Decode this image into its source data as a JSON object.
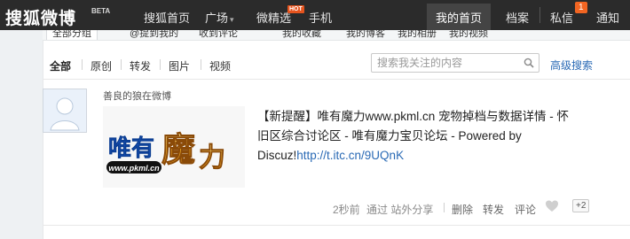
{
  "topnav": {
    "logo": "搜狐微博",
    "beta": "BETA",
    "items": [
      "搜狐首页",
      "广场",
      "微精选",
      "手机",
      "我的首页",
      "档案",
      "私信",
      "通知"
    ],
    "hot_badge": "HOT",
    "message_count": "1",
    "plaza_caret": "▾"
  },
  "groupbar": {
    "items": [
      "全部分组",
      "@提到我的",
      "收到评论",
      "我的收藏",
      "我的博客",
      "我的相册",
      "我的视频"
    ]
  },
  "filters": {
    "items": [
      "全部",
      "原创",
      "转发",
      "图片",
      "视频"
    ]
  },
  "search": {
    "placeholder": "搜索我关注的内容",
    "advanced_label": "高级搜索"
  },
  "post": {
    "author": "善良的狼在微博",
    "thumbnail": {
      "logo_text": "唯有魔力",
      "url_text": "www.pkml.cn"
    },
    "text_lines": [
      "【新提醒】唯有魔力www.pkml.cn 宠物掉档与数据详情 - 怀",
      "旧区综合讨论区 - 唯有魔力宝贝论坛 - Powered by"
    ],
    "text_tail": "Discuz!",
    "link": "http://t.itc.cn/9UQnK",
    "meta": {
      "time": "2秒前",
      "via": "通过 站外分享",
      "delete": "删除",
      "repost": "转发",
      "comment": "评论",
      "like_extra": "+2"
    }
  },
  "colors": {
    "topbar": "#2b2b2b",
    "link": "#2a6ab5",
    "hot": "#e6541e",
    "badge": "#f26522"
  }
}
